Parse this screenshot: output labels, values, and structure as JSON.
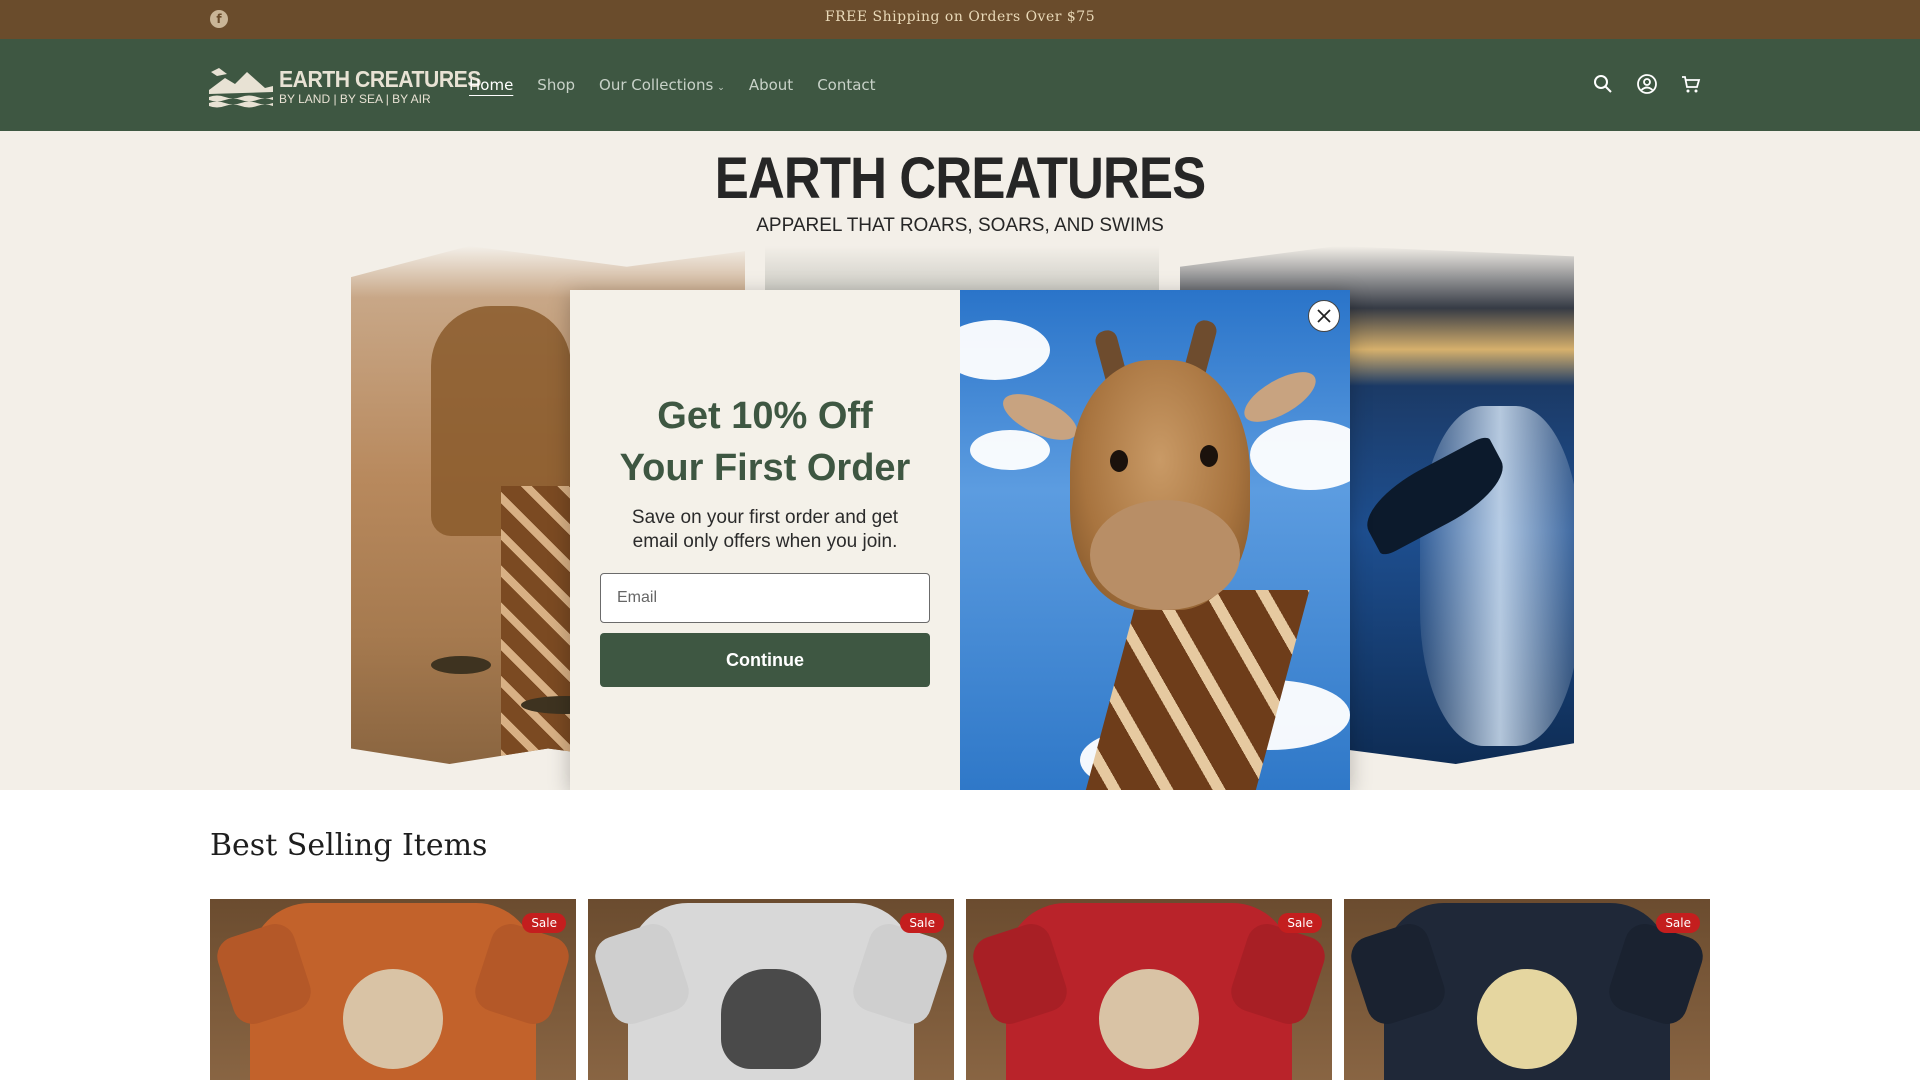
{
  "announcement": {
    "text": "FREE Shipping on Orders Over $75",
    "facebook_glyph": "f"
  },
  "header": {
    "logo_name": "EARTH CREATURES",
    "logo_tagline": "BY LAND | BY SEA | BY AIR",
    "nav": [
      {
        "label": "Home"
      },
      {
        "label": "Shop"
      },
      {
        "label": "Our Collections"
      },
      {
        "label": "About"
      },
      {
        "label": "Contact"
      }
    ],
    "icons": [
      "search-icon",
      "account-icon",
      "cart-icon"
    ]
  },
  "hero": {
    "brand": "EARTH CREATURES",
    "slogan": "APPAREL THAT ROARS, SOARS, AND SWIMS"
  },
  "modal": {
    "title_line1": "Get 10% Off",
    "title_line2": "Your First Order",
    "subtitle": "Save on your first order and get email only offers when you join.",
    "email_placeholder": "Email",
    "email_value": "",
    "button_label": "Continue"
  },
  "best_sellers": {
    "title": "Best Selling Items",
    "products": [
      {
        "badge": "Sale",
        "shirt_color": "#c2622b"
      },
      {
        "badge": "Sale",
        "shirt_color": "#d8d8d8"
      },
      {
        "badge": "Sale",
        "shirt_color": "#b9232a"
      },
      {
        "badge": "Sale",
        "shirt_color": "#1f2838"
      }
    ]
  },
  "colors": {
    "announcement_bg": "#6a4c2c",
    "header_bg": "#3e5742",
    "accent": "#3e5742",
    "sale_badge": "#c41e1e"
  }
}
